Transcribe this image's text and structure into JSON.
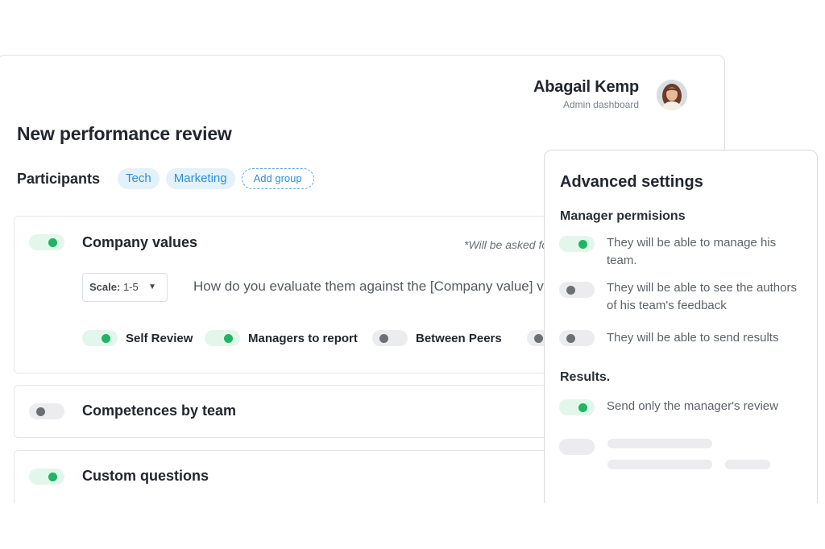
{
  "header": {
    "user_name": "Abagail Kemp",
    "user_role": "Admin dashboard"
  },
  "page": {
    "title": "New performance review",
    "participants_label": "Participants",
    "groups": [
      "Tech",
      "Marketing"
    ],
    "add_group_label": "Add group"
  },
  "sections": {
    "company_values": {
      "title": "Company values",
      "enabled": true,
      "asked_note": "*Will be asked fo",
      "scale_prefix": "Scale:",
      "scale_value": "1-5",
      "question": "How do you evaluate them against the [Company value] va",
      "reviewers": [
        {
          "label": "Self Review",
          "enabled": true
        },
        {
          "label": "Managers to report",
          "enabled": true
        },
        {
          "label": "Between Peers",
          "enabled": false
        }
      ]
    },
    "competences": {
      "title": "Competences by team",
      "enabled": false
    },
    "custom_questions": {
      "title": "Custom questions",
      "enabled": true
    }
  },
  "advanced_settings": {
    "title": "Advanced settings",
    "manager_permissions_label": "Manager permisions",
    "permissions": [
      {
        "label": "They will be able to manage his team.",
        "enabled": true
      },
      {
        "label": "They will be able to see the authors of his team's feedback",
        "enabled": false
      },
      {
        "label": "They will be able to send results",
        "enabled": false
      }
    ],
    "results_label": "Results.",
    "results_options": [
      {
        "label": "Send only the manager's review",
        "enabled": true
      }
    ]
  },
  "colors": {
    "accent_green": "#1fb564",
    "accent_blue": "#2e8fd6",
    "text_dark": "#23262f"
  }
}
